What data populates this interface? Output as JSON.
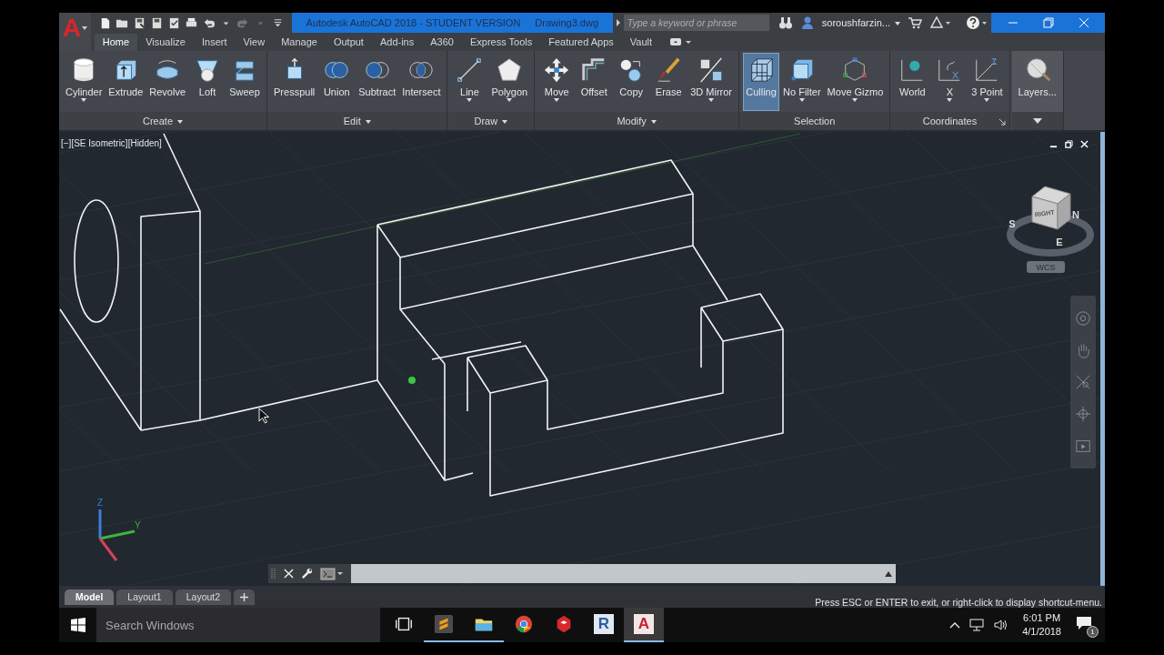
{
  "app_button": {
    "letter": "A"
  },
  "quick_access": [
    {
      "disabled": false
    },
    {
      "disabled": false
    },
    {
      "disabled": false
    },
    {
      "disabled": false
    },
    {
      "disabled": false
    },
    {
      "disabled": false
    },
    {
      "disabled": false
    },
    {
      "disabled": false
    },
    {
      "disabled": true
    },
    {
      "disabled": true
    },
    {
      "disabled": false
    }
  ],
  "title": {
    "app": "Autodesk AutoCAD 2018 - STUDENT VERSION",
    "file": "Drawing3.dwg"
  },
  "search": {
    "placeholder": "Type a keyword or phrase"
  },
  "user": {
    "name": "soroushfarzin..."
  },
  "tabs": [
    {
      "label": "Home",
      "selected": true
    },
    {
      "label": "Visualize",
      "selected": false
    },
    {
      "label": "Insert",
      "selected": false
    },
    {
      "label": "View",
      "selected": false
    },
    {
      "label": "Manage",
      "selected": false
    },
    {
      "label": "Output",
      "selected": false
    },
    {
      "label": "Add-ins",
      "selected": false
    },
    {
      "label": "A360",
      "selected": false
    },
    {
      "label": "Express Tools",
      "selected": false
    },
    {
      "label": "Featured Apps",
      "selected": false
    },
    {
      "label": "Vault",
      "selected": false
    }
  ],
  "ribbon": {
    "panels": [
      {
        "title": "Create",
        "menu": true,
        "launcher": false,
        "collapsed": false,
        "tools": [
          {
            "label": "Cylinder",
            "dropdown": true,
            "on": false
          },
          {
            "label": "Extrude",
            "dropdown": false,
            "on": false
          },
          {
            "label": "Revolve",
            "dropdown": false,
            "on": false
          },
          {
            "label": "Loft",
            "dropdown": false,
            "on": false
          },
          {
            "label": "Sweep",
            "dropdown": false,
            "on": false
          }
        ]
      },
      {
        "title": "Edit",
        "menu": true,
        "launcher": false,
        "collapsed": false,
        "tools": [
          {
            "label": "Presspull",
            "dropdown": false,
            "on": false
          },
          {
            "label": "Union",
            "dropdown": false,
            "on": false
          },
          {
            "label": "Subtract",
            "dropdown": false,
            "on": false
          },
          {
            "label": "Intersect",
            "dropdown": false,
            "on": false
          }
        ]
      },
      {
        "title": "Draw",
        "menu": true,
        "launcher": false,
        "collapsed": false,
        "tools": [
          {
            "label": "Line",
            "dropdown": true,
            "on": false
          },
          {
            "label": "Polygon",
            "dropdown": true,
            "on": false
          }
        ]
      },
      {
        "title": "Modify",
        "menu": true,
        "launcher": false,
        "collapsed": false,
        "tools": [
          {
            "label": "Move",
            "dropdown": true,
            "on": false
          },
          {
            "label": "Offset",
            "dropdown": false,
            "on": false
          },
          {
            "label": "Copy",
            "dropdown": false,
            "on": false
          },
          {
            "label": "Erase",
            "dropdown": false,
            "on": false
          },
          {
            "label": "3D Mirror",
            "dropdown": true,
            "on": false
          }
        ]
      },
      {
        "title": "Selection",
        "menu": false,
        "launcher": false,
        "collapsed": false,
        "tools": [
          {
            "label": "Culling",
            "dropdown": false,
            "on": true
          },
          {
            "label": "No Filter",
            "dropdown": true,
            "on": false
          },
          {
            "label": "Move Gizmo",
            "dropdown": true,
            "on": false
          }
        ]
      },
      {
        "title": "Coordinates",
        "menu": false,
        "launcher": true,
        "collapsed": false,
        "tools": [
          {
            "label": "World",
            "dropdown": false,
            "on": false
          },
          {
            "label": "X",
            "dropdown": true,
            "on": false
          },
          {
            "label": "3 Point",
            "dropdown": true,
            "on": false
          }
        ]
      },
      {
        "menu": true,
        "launcher": false,
        "collapsed": true,
        "tools": [
          {
            "label": "Layers...",
            "dropdown": false,
            "on": false
          }
        ]
      }
    ]
  },
  "viewport": {
    "label": "[−][SE Isometric][Hidden]",
    "viewcube": {
      "face": "RIGHT",
      "compass": [
        "N",
        "E",
        "S"
      ]
    },
    "ucs_button": "WCS",
    "axes": [
      "Z",
      "Y"
    ]
  },
  "layout_tabs": [
    {
      "label": "Model",
      "selected": true
    },
    {
      "label": "Layout1",
      "selected": false
    },
    {
      "label": "Layout2",
      "selected": false
    }
  ],
  "status_message": "Press ESC or ENTER to exit, or right-click to display shortcut-menu.",
  "taskbar": {
    "search_placeholder": "Search Windows",
    "apps": [
      {
        "running": false,
        "selected": false
      },
      {
        "running": true,
        "selected": false
      },
      {
        "running": true,
        "selected": false
      },
      {
        "running": false,
        "selected": false
      },
      {
        "running": false,
        "selected": false
      },
      {
        "running": false,
        "selected": false,
        "logo_letter": "R"
      },
      {
        "running": true,
        "selected": true,
        "logo_letter": "A"
      }
    ],
    "time": "6:01 PM",
    "date": "4/1/2018",
    "notifications": "1"
  }
}
